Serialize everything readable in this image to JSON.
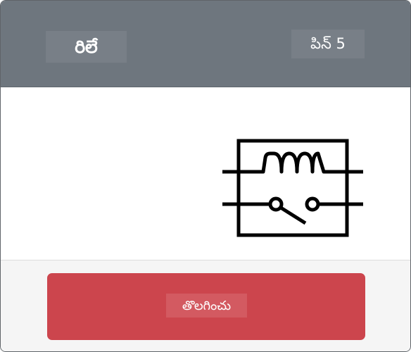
{
  "header": {
    "title": "రిలే",
    "pin_label": "పిన్ 5"
  },
  "component": {
    "icon": "relay-icon"
  },
  "footer": {
    "remove_label": "తొలగించు"
  },
  "colors": {
    "header_bg": "#6e767e",
    "button_bg": "#cc454d",
    "footer_bg": "#f5f5f5"
  }
}
